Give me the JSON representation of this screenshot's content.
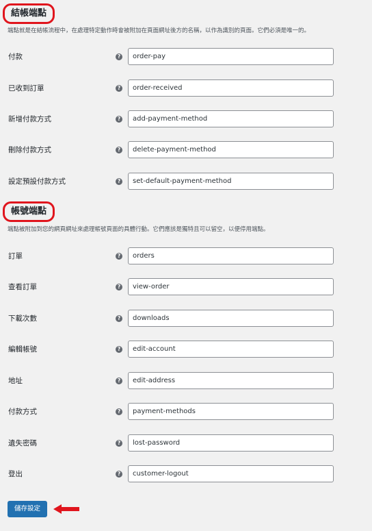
{
  "checkout": {
    "title": "結帳端點",
    "description": "端點就是在結帳流程中，在處理特定動作時會被附加在頁面網址後方的名稱，以作為識別的頁面。它們必須是唯一的。",
    "rows": [
      {
        "label": "付款",
        "value": "order-pay"
      },
      {
        "label": "已收到訂單",
        "value": "order-received"
      },
      {
        "label": "新增付款方式",
        "value": "add-payment-method"
      },
      {
        "label": "刪除付款方式",
        "value": "delete-payment-method"
      },
      {
        "label": "設定預設付款方式",
        "value": "set-default-payment-method"
      }
    ]
  },
  "account": {
    "title": "帳號端點",
    "description": "端點被附加到您的網頁網址來處理帳號頁面的具體行動。它們應該是獨特且可以留空，以便停用端點。",
    "rows": [
      {
        "label": "訂單",
        "value": "orders"
      },
      {
        "label": "查看訂單",
        "value": "view-order"
      },
      {
        "label": "下載次數",
        "value": "downloads"
      },
      {
        "label": "編輯帳號",
        "value": "edit-account"
      },
      {
        "label": "地址",
        "value": "edit-address"
      },
      {
        "label": "付款方式",
        "value": "payment-methods"
      },
      {
        "label": "遺失密碼",
        "value": "lost-password"
      },
      {
        "label": "登出",
        "value": "customer-logout"
      }
    ]
  },
  "help_icon": {
    "glyph": "?",
    "name": "help-icon"
  },
  "save_label": "儲存設定",
  "colors": {
    "highlight": "#e0151d",
    "button": "#2271b1",
    "background": "#f1f1f1"
  }
}
